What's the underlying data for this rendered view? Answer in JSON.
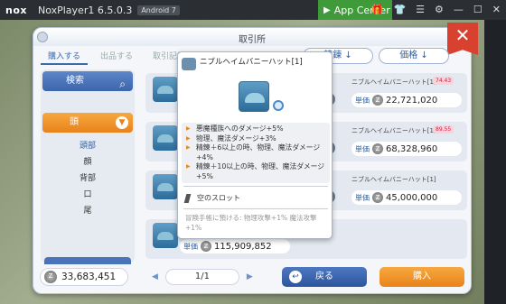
{
  "emulator": {
    "logo": "nox",
    "title": "NoxPlayer1 6.5.0.3",
    "android_badge": "Android 7",
    "app_center": "App Center",
    "icons": [
      "gift-icon",
      "shirt-icon",
      "menu-icon",
      "gear-icon",
      "minimize-icon",
      "maximize-icon",
      "close-icon"
    ]
  },
  "dialog": {
    "title": "取引所",
    "close_label": "✕",
    "tabs": [
      {
        "label": "購入する",
        "active": true
      },
      {
        "label": "出品する",
        "active": false
      },
      {
        "label": "取引記録",
        "active": false
      }
    ],
    "sort_buttons": [
      {
        "label": "精錬 ↓"
      },
      {
        "label": "価格 ↓"
      }
    ]
  },
  "left_panel": {
    "search_label": "検索",
    "category_label": "頭",
    "categories": [
      {
        "label": "頭部",
        "selected": true
      },
      {
        "label": "顔",
        "selected": false
      },
      {
        "label": "背部",
        "selected": false
      },
      {
        "label": "口",
        "selected": false
      },
      {
        "label": "尾",
        "selected": false
      }
    ]
  },
  "listings": [
    {
      "name": "ニブルヘイムバニーハット[1]",
      "qty": "74.43",
      "unit_label": "単価",
      "price": "22,721,020"
    },
    {
      "name": "ニブルヘイムバニーハット[1]",
      "qty": "89.55",
      "unit_label": "単価",
      "price": "68,328,960"
    },
    {
      "name": "ニブルヘイムバニーハット[1]",
      "qty": "",
      "unit_label": "単価",
      "price": "45,000,000"
    },
    {
      "name": "",
      "qty": "",
      "unit_label": "単価",
      "price": "115,909,852"
    }
  ],
  "tooltip": {
    "name": "ニブルヘイムバニーハット[1]",
    "effects": [
      "悪魔種族へのダメージ+5%",
      "物理、魔法ダメージ+3%",
      "精錬＋6以上の時、物理、魔法ダメージ+4%",
      "精錬＋10以上の時、物理、魔法ダメージ+5%"
    ],
    "slot_label": "空のスロット",
    "note": "冒険手帳に預ける: 物理攻撃+1% 魔法攻撃+1%"
  },
  "footer": {
    "zeny": "33,683,451",
    "page": "1/1",
    "back_label": "戻る",
    "buy_label": "購入"
  }
}
